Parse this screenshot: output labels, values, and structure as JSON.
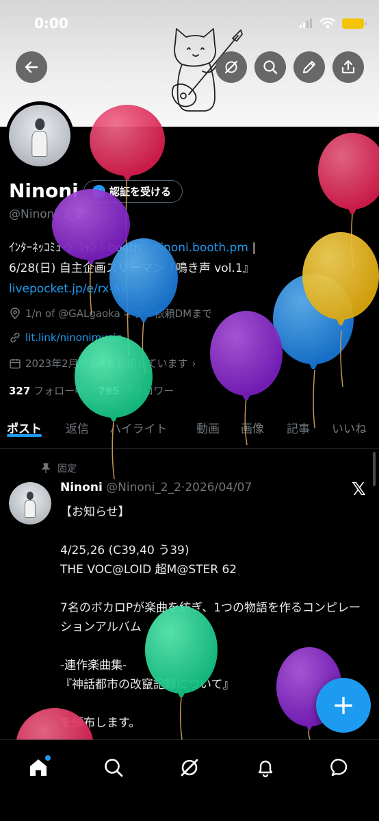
{
  "status": {
    "time": "0:00"
  },
  "profile": {
    "name": "Ninoni",
    "verify_label": "認証を受ける",
    "handle": "@Ninoni_2_2",
    "bio_line1_prefix": "ｲﾝﾀｰﾈｯｺﾐｭｰｼﾞｼｬﾝ｜booth：",
    "bio_line1_link": "ninoni.booth.pm",
    "bio_line1_suffix": " |",
    "bio_line2": "6/28(日) 自主企画スリーマン『鳴き声 vol.1』",
    "bio_line3_link": "livepocket.jp/e/rx-6k",
    "location": "1/n of @GALgaoka ギター依頼DMまで",
    "website": "lit.link/ninonimusic",
    "joined": "2023年2月からXを利用しています",
    "following_count": "327",
    "following_label": "フォロー中",
    "followers_count": "795",
    "followers_label": "フォロワー"
  },
  "tabs": [
    {
      "label": "ポスト",
      "active": true
    },
    {
      "label": "返信"
    },
    {
      "label": "ハイライト"
    },
    {
      "label": "動画"
    },
    {
      "label": "画像"
    },
    {
      "label": "記事"
    },
    {
      "label": "いいね"
    }
  ],
  "post": {
    "pinned_label": "固定",
    "author": "Ninoni",
    "meta": " @Ninoni_2_2·2026/04/07",
    "lines": [
      "【お知らせ】",
      "",
      "4/25,26 (C39,40 う39)",
      "THE VOC@LOID 超M@STER 62",
      "",
      "7名のボカロPが楽曲を紡ぎ、1つの物語を作るコンピレーションアルバム",
      "",
      "-連作楽曲集-",
      "『神話都市の改竄記録について』",
      "",
      "を頒布します。"
    ]
  },
  "fab_label": "+",
  "icons": {
    "back": "back-arrow-icon",
    "grok": "grok-icon",
    "search": "search-icon",
    "edit": "pencil-icon",
    "share": "share-icon",
    "home": "home-icon",
    "notifications": "bell-icon",
    "messages": "message-bubble-icon"
  },
  "colors": {
    "accent": "#1d9bf0",
    "background": "#000000"
  }
}
